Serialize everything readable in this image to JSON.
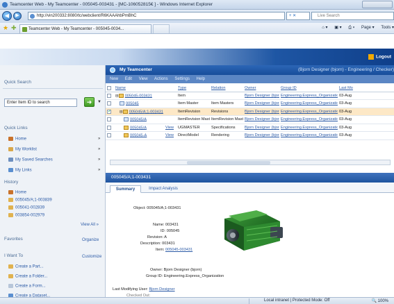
{
  "window": {
    "title": "Teamcenter Web - My Teamcenter - 005045-003431 - [MC-106052815€ ] - Windows Internet Explorer"
  },
  "address_bar": {
    "url": "http://vin200332:8080/tc/webclient/R6KAAAhbPmBhC",
    "refresh_label": "+ ✕",
    "search_placeholder": "Live Search"
  },
  "favorites_bar": {
    "tab_label": "Teamcenter Web - My Teamcenter - 005045-0034...",
    "commands": [
      "Page ▾",
      "Tools ▾"
    ]
  },
  "banner": {
    "logout_label": "Logout"
  },
  "left": {
    "quick_search_header": "Quick Search",
    "quick_search_placeholder": "Enter Item ID to search",
    "quick_links_header": "Quick Links",
    "quick_links": [
      {
        "label": "Home",
        "color": "#c9722b"
      },
      {
        "label": "My Worklist",
        "color": "#d8a74a"
      },
      {
        "label": "My Saved Searches",
        "color": "#6d8fbf"
      },
      {
        "label": "My Links",
        "color": "#5a8fd0"
      }
    ],
    "history_header": "History",
    "history": [
      {
        "label": "Home",
        "color": "#c9722b"
      },
      {
        "label": "005045/A;1-003839",
        "color": "#e0b24f"
      },
      {
        "label": "005041-002839",
        "color": "#e0b24f"
      },
      {
        "label": "003854-002979",
        "color": "#e0b24f"
      }
    ],
    "view_all": "View All",
    "favorites_header": "Favorites",
    "organize": "Organize",
    "i_want_to_header": "I Want To",
    "customize": "Customize",
    "i_want_to": [
      {
        "label": "Create a Part...",
        "color": "#e0b24f"
      },
      {
        "label": "Create a Folder...",
        "color": "#e0b24f"
      },
      {
        "label": "Create a Form...",
        "color": "#b7c6d9"
      },
      {
        "label": "Create a Dataset...",
        "color": "#5a8fd0"
      }
    ]
  },
  "main": {
    "title": "My Teamcenter",
    "user_context": "(Bjorn Designer (bjorn) - Engineering / Checker)",
    "menu": [
      "New",
      "Edit",
      "View",
      "Actions",
      "Settings",
      "Help"
    ],
    "columns": [
      "Name",
      "Type",
      "Relation",
      "Owner",
      "Group ID",
      "Last Mo"
    ],
    "rows": [
      {
        "checked": false,
        "indent": 0,
        "expander": "⊟",
        "icon": "part",
        "name": "005045-003431",
        "view": "",
        "type": "Item",
        "relation": "",
        "owner": "Bjorn Designer (bjorn)",
        "group": "Engineering.Express_Organization",
        "modified": "03-Aug",
        "selected": false
      },
      {
        "checked": false,
        "indent": 1,
        "expander": "",
        "icon": "doc",
        "name": "005045",
        "view": "",
        "type": "Item Master",
        "relation": "Item Masters",
        "owner": "Bjorn Designer (bjorn)",
        "group": "Engineering.Express_Organization",
        "modified": "03-Aug",
        "selected": false
      },
      {
        "checked": true,
        "indent": 1,
        "expander": "⊟",
        "icon": "part",
        "name": "005045/A;1-003431",
        "view": "",
        "type": "ItemRevision",
        "relation": "Revisions",
        "owner": "Bjorn Designer (bjorn)",
        "group": "Engineering.Express_Organization",
        "modified": "03-Aug",
        "selected": true
      },
      {
        "checked": false,
        "indent": 2,
        "expander": "",
        "icon": "doc",
        "name": "005045/A",
        "view": "",
        "type": "ItemRevision Master",
        "relation": "ItemRevision Master",
        "owner": "Bjorn Designer (bjorn)",
        "group": "Engineering.Express_Organization",
        "modified": "03-Aug",
        "selected": false
      },
      {
        "checked": false,
        "indent": 2,
        "expander": "",
        "icon": "part",
        "name": "005045/A",
        "view": "View",
        "type": "UGMASTER",
        "relation": "Specifications",
        "owner": "Bjorn Designer (bjorn)",
        "group": "Engineering.Express_Organization",
        "modified": "03-Aug",
        "selected": false
      },
      {
        "checked": false,
        "indent": 2,
        "expander": "",
        "icon": "part",
        "name": "005045-A",
        "view": "View",
        "type": "DirectModel",
        "relation": "Rendering",
        "owner": "Bjorn Designer (bjorn)",
        "group": "Engineering.Express_Organization",
        "modified": "03-Aug",
        "selected": false
      }
    ],
    "detail_title": "005045/A;1-003431",
    "detail_tabs": [
      "Summary",
      "Impact Analysis"
    ],
    "props": {
      "object_label": "Object:",
      "object_value": "005045/A;1-003431",
      "name_label": "Name:",
      "name_value": "003431",
      "id_label": "ID:",
      "id_value": "005045",
      "revision_label": "Revision:",
      "revision_value": "A",
      "description_label": "Description:",
      "description_value": "003431",
      "item_label": "Item:",
      "item_value": "005045-003431",
      "owner_label": "Owner:",
      "owner_value": "Bjorn Designer (bjorn)",
      "group_label": "Group ID:",
      "group_value": "Engineering.Express_Organization",
      "last_mod_label": "Last Modifying User:",
      "last_mod_value": "Bjorn Designer",
      "checked_out_label": "Checked Out:"
    }
  },
  "status": {
    "zone": "Local intranet | Protected Mode: Off",
    "zoom": "100%"
  }
}
